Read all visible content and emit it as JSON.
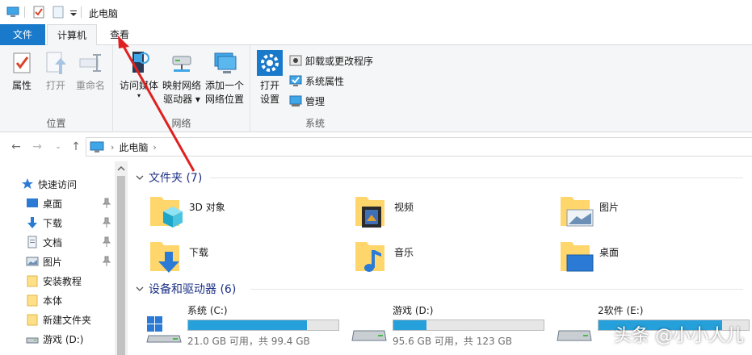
{
  "window": {
    "title": "此电脑"
  },
  "ribbon_tabs": [
    {
      "label": "文件"
    },
    {
      "label": "计算机"
    },
    {
      "label": "查看"
    }
  ],
  "ribbon": {
    "location_group": {
      "label": "位置",
      "buttons": [
        "属性",
        "打开",
        "重命名"
      ]
    },
    "network_group": {
      "label": "网络",
      "buttons": [
        {
          "line1": "访问媒体",
          "line2": ""
        },
        {
          "line1": "映射网络",
          "line2": "驱动器 ▾"
        },
        {
          "line1": "添加一个",
          "line2": "网络位置"
        }
      ]
    },
    "system_group": {
      "label": "系统",
      "open_settings": {
        "line1": "打开",
        "line2": "设置"
      },
      "small_buttons": [
        "卸载或更改程序",
        "系统属性",
        "管理"
      ]
    }
  },
  "address_bar": {
    "crumb": "此电脑"
  },
  "sidebar": {
    "items": [
      {
        "label": "快速访问",
        "icon": "star-icon",
        "pinned": false
      },
      {
        "label": "桌面",
        "icon": "desktop-icon",
        "pinned": true
      },
      {
        "label": "下载",
        "icon": "download-icon",
        "pinned": true
      },
      {
        "label": "文档",
        "icon": "document-icon",
        "pinned": true
      },
      {
        "label": "图片",
        "icon": "picture-icon",
        "pinned": true
      },
      {
        "label": "安装教程",
        "icon": "folder-icon",
        "pinned": false
      },
      {
        "label": "本体",
        "icon": "folder-icon",
        "pinned": false
      },
      {
        "label": "新建文件夹",
        "icon": "folder-icon",
        "pinned": false
      },
      {
        "label": "游戏 (D:)",
        "icon": "drive-icon",
        "pinned": false
      }
    ]
  },
  "folders_section": {
    "title": "文件夹 (7)",
    "items": [
      {
        "name": "3D 对象",
        "icon": "3d-objects-folder-icon"
      },
      {
        "name": "视频",
        "icon": "videos-folder-icon"
      },
      {
        "name": "图片",
        "icon": "pictures-folder-icon"
      },
      {
        "name": "下载",
        "icon": "downloads-folder-icon"
      },
      {
        "name": "音乐",
        "icon": "music-folder-icon"
      },
      {
        "name": "桌面",
        "icon": "desktop-folder-icon"
      }
    ]
  },
  "drives_section": {
    "title": "设备和驱动器 (6)",
    "items": [
      {
        "name": "系统 (C:)",
        "free": "21.0 GB 可用，共 99.4 GB",
        "used_fraction": 0.79,
        "icon": "windows-drive-icon"
      },
      {
        "name": "游戏 (D:)",
        "free": "95.6 GB 可用，共 123 GB",
        "used_fraction": 0.22,
        "icon": "drive-icon"
      },
      {
        "name": "2软件 (E:)",
        "free": "",
        "used_fraction": 0.82,
        "icon": "drive-icon"
      }
    ]
  },
  "watermark": "头条 @小小人儿",
  "colors": {
    "accent": "#1979ca",
    "bar_fill": "#26a0da",
    "section_heading": "#1e3287",
    "annotation_arrow": "#e02020"
  }
}
